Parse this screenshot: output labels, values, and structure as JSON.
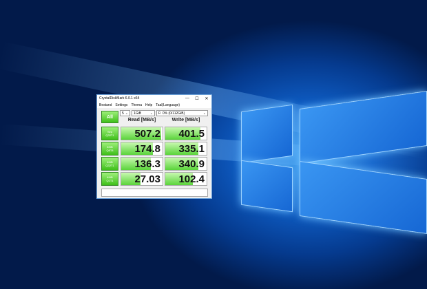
{
  "window": {
    "title": "CrystalDiskMark 6.0.1 x64",
    "controls": [
      "—",
      "☐",
      "✕"
    ]
  },
  "menu": [
    "Bestand",
    "Settings",
    "Thema",
    "Help",
    "Taal(Language)"
  ],
  "controls": {
    "count": "5",
    "size": "1GiB",
    "drive": "F: 0% (0/112GiB)"
  },
  "all_label": "All",
  "headers": {
    "read": "Read [MB/s]",
    "write": "Write [MB/s]"
  },
  "rows": [
    {
      "l1": "Seq",
      "l2": "Q32T1",
      "read": "507.2",
      "write": "401.5",
      "read_fill": 0.97,
      "write_fill": 0.85
    },
    {
      "l1": "4KiB",
      "l2": "Q8T8",
      "read": "174.8",
      "write": "335.1",
      "read_fill": 0.77,
      "write_fill": 0.8
    },
    {
      "l1": "4KiB",
      "l2": "Q32T1",
      "read": "136.3",
      "write": "340.9",
      "read_fill": 0.72,
      "write_fill": 0.8
    },
    {
      "l1": "4KiB",
      "l2": "Q1T1",
      "read": "27.03",
      "write": "102.4",
      "read_fill": 0.47,
      "write_fill": 0.66
    }
  ],
  "comment": ""
}
